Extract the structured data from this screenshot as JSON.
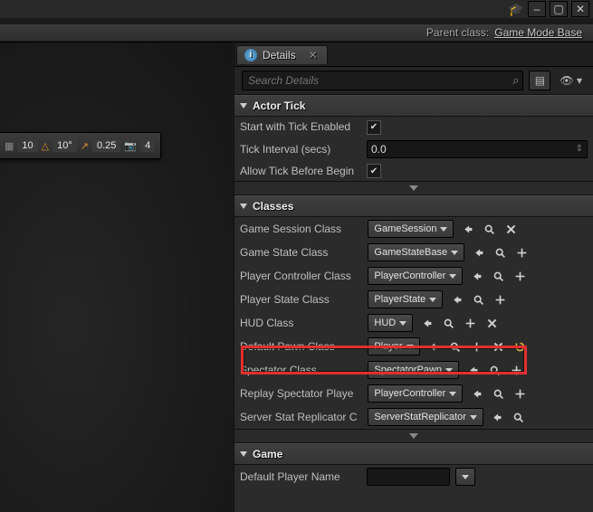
{
  "window": {
    "parent_class_label": "Parent class:",
    "parent_class_value": "Game Mode Base"
  },
  "details": {
    "tab_label": "Details",
    "search_placeholder": "Search Details"
  },
  "viewport_toolbar": {
    "snap_grid": "10",
    "snap_angle": "10°",
    "snap_scale": "0.25",
    "cam_speed": "4"
  },
  "categories": {
    "actor_tick": {
      "title": "Actor Tick"
    },
    "classes": {
      "title": "Classes"
    },
    "game": {
      "title": "Game"
    }
  },
  "actor_tick": {
    "start_with_tick_enabled": {
      "label": "Start with Tick Enabled",
      "checked": true
    },
    "tick_interval": {
      "label": "Tick Interval (secs)",
      "value": "0.0"
    },
    "allow_tick_before_begin": {
      "label": "Allow Tick Before Begin",
      "checked": true
    }
  },
  "classes": {
    "game_session": {
      "label": "Game Session Class",
      "value": "GameSession",
      "icons": [
        "back",
        "browse",
        "clear"
      ]
    },
    "game_state": {
      "label": "Game State Class",
      "value": "GameStateBase",
      "icons": [
        "back",
        "browse",
        "add"
      ]
    },
    "player_controller": {
      "label": "Player Controller Class",
      "value": "PlayerController",
      "icons": [
        "back",
        "browse",
        "add"
      ]
    },
    "player_state": {
      "label": "Player State Class",
      "value": "PlayerState",
      "icons": [
        "back",
        "browse",
        "add"
      ]
    },
    "hud": {
      "label": "HUD Class",
      "value": "HUD",
      "icons": [
        "back",
        "browse",
        "add",
        "clear"
      ]
    },
    "default_pawn": {
      "label": "Default Pawn Class",
      "value": "Player",
      "icons": [
        "back",
        "browse",
        "add",
        "clear",
        "revert"
      ]
    },
    "spectator": {
      "label": "Spectator Class",
      "value": "SpectatorPawn",
      "icons": [
        "back",
        "browse",
        "add"
      ]
    },
    "replay_spectator": {
      "label": "Replay Spectator Playe",
      "value": "PlayerController",
      "icons": [
        "back",
        "browse",
        "add"
      ]
    },
    "server_stat": {
      "label": "Server Stat Replicator C",
      "value": "ServerStatReplicator",
      "icons": [
        "back",
        "browse"
      ]
    }
  },
  "game": {
    "default_player_name": {
      "label": "Default Player Name",
      "value": ""
    }
  },
  "colors": {
    "highlight": "#e42e2e",
    "revert": "#d6b23a"
  }
}
